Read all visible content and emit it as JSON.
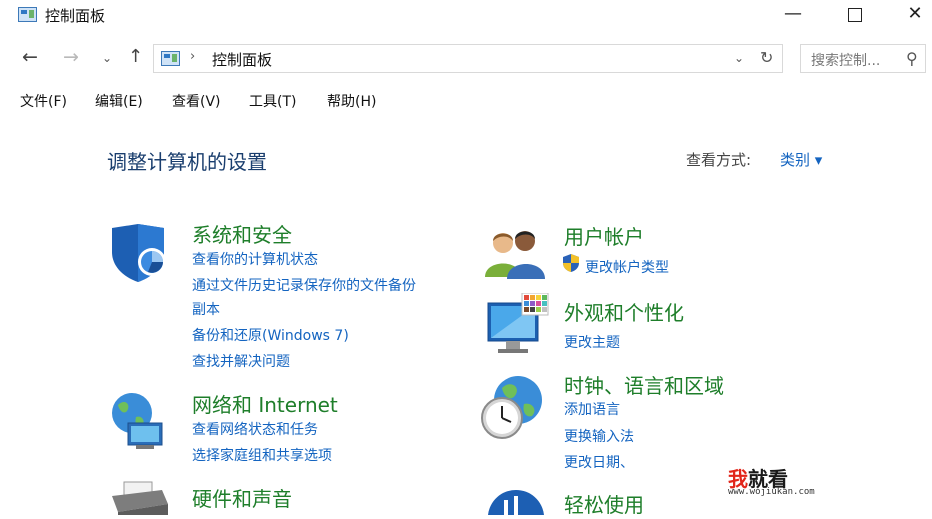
{
  "window": {
    "title": "控制面板",
    "minimize_glyph": "—",
    "close_glyph": "✕"
  },
  "nav": {
    "back_glyph": "←",
    "forward_glyph": "→",
    "recent_glyph": "⌄",
    "up_glyph": "↑",
    "address_sep": "›",
    "address_text": "控制面板",
    "address_drop_glyph": "⌄",
    "refresh_glyph": "↻",
    "search_placeholder": "搜索控制...",
    "search_glyph": "⚲"
  },
  "menu": {
    "file": "文件(F)",
    "edit": "编辑(E)",
    "view": "查看(V)",
    "tools": "工具(T)",
    "help": "帮助(H)"
  },
  "main": {
    "heading": "调整计算机的设置",
    "view_by_label": "查看方式:",
    "view_by_value": "类别 ▾"
  },
  "categories": {
    "system": {
      "title": "系统和安全",
      "links": [
        "查看你的计算机状态",
        "通过文件历史记录保存你的文件备份",
        "副本",
        "备份和还原(Windows 7)",
        "查找并解决问题"
      ]
    },
    "users": {
      "title": "用户帐户",
      "links": [
        "更改帐户类型"
      ]
    },
    "appearance": {
      "title": "外观和个性化",
      "links": [
        "更改主题"
      ]
    },
    "network": {
      "title": "网络和 Internet",
      "links": [
        "查看网络状态和任务",
        "选择家庭组和共享选项"
      ]
    },
    "clock": {
      "title": "时钟、语言和区域",
      "links": [
        "添加语言",
        "更换输入法",
        "更改日期、"
      ]
    },
    "hardware": {
      "title": "硬件和声音"
    },
    "ease": {
      "title": "轻松使用"
    }
  },
  "watermark": {
    "main_accent": "我",
    "main_rest": "就看",
    "sub": "www.wojiukan.com"
  },
  "colors": {
    "category_title": "#1e7e2a",
    "link": "#1464c0",
    "heading": "#1a3e6e"
  }
}
